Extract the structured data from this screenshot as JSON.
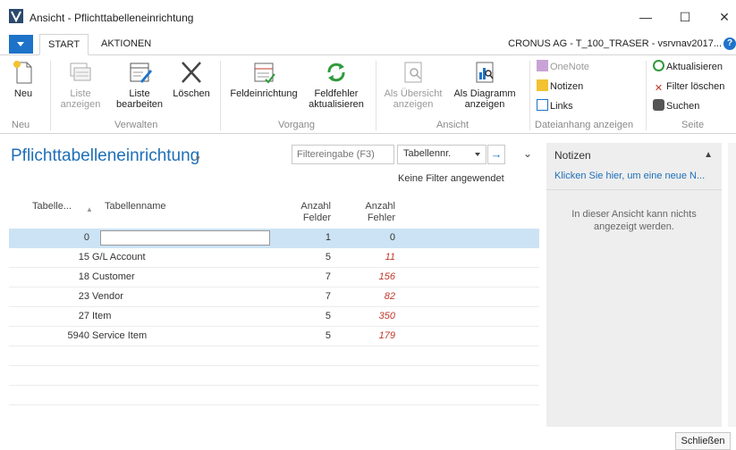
{
  "window": {
    "title": "Ansicht - Pflichttabelleneinrichtung",
    "minimize": "—",
    "maximize": "☐",
    "close": "✕"
  },
  "tabs": [
    {
      "label": "START",
      "active": true
    },
    {
      "label": "AKTIONEN",
      "active": false
    }
  ],
  "company": "CRONUS AG - T_100_TRASER - vsrvnav2017...",
  "ribbon": {
    "groups": [
      {
        "label": "Neu"
      },
      {
        "label": "Verwalten"
      },
      {
        "label": "Vorgang"
      },
      {
        "label": "Ansicht"
      },
      {
        "label": "Dateianhang anzeigen"
      },
      {
        "label": "Seite"
      }
    ],
    "buttons": {
      "neu": "Neu",
      "liste_anzeigen_1": "Liste",
      "liste_anzeigen_2": "anzeigen",
      "liste_bearbeiten_1": "Liste",
      "liste_bearbeiten_2": "bearbeiten",
      "loeschen": "Löschen",
      "feldeinrichtung": "Feldeinrichtung",
      "feldfehler_1": "Feldfehler",
      "feldfehler_2": "aktualisieren",
      "als_uebersicht_1": "Als Übersicht",
      "als_uebersicht_2": "anzeigen",
      "als_diagramm_1": "Als Diagramm",
      "als_diagramm_2": "anzeigen",
      "onenote": "OneNote",
      "notizen": "Notizen",
      "links": "Links",
      "aktualisieren": "Aktualisieren",
      "filter_loeschen": "Filter löschen",
      "suchen": "Suchen"
    }
  },
  "page": {
    "title": "Pflichttabelleneinrichtung",
    "title_caret": "▾"
  },
  "filter": {
    "placeholder": "Filtereingabe (F3)",
    "field": "Tabellennr.",
    "go": "→",
    "expand": "⌄",
    "status": "Keine Filter angewendet"
  },
  "table": {
    "headers": {
      "col1": "Tabelle...",
      "col2": "Tabellenname",
      "col3_1": "Anzahl",
      "col3_2": "Felder",
      "col4_1": "Anzahl",
      "col4_2": "Fehler"
    },
    "rows": [
      {
        "nr": "0",
        "name": "",
        "felder": "1",
        "fehler": "0",
        "selected": true
      },
      {
        "nr": "15",
        "name": "G/L Account",
        "felder": "5",
        "fehler": "11"
      },
      {
        "nr": "18",
        "name": "Customer",
        "felder": "7",
        "fehler": "156"
      },
      {
        "nr": "23",
        "name": "Vendor",
        "felder": "7",
        "fehler": "82"
      },
      {
        "nr": "27",
        "name": "Item",
        "felder": "5",
        "fehler": "350"
      },
      {
        "nr": "5940",
        "name": "Service Item",
        "felder": "5",
        "fehler": "179"
      }
    ]
  },
  "notes": {
    "title": "Notizen",
    "link": "Klicken Sie hier, um eine neue N...",
    "empty": "In dieser Ansicht kann nichts angezeigt werden."
  },
  "footer": {
    "close": "Schließen"
  },
  "colors": {
    "accent": "#1e73c9",
    "title": "#1e6fb8",
    "selected_row": "#cce3f5",
    "error_value": "#c0392b"
  }
}
